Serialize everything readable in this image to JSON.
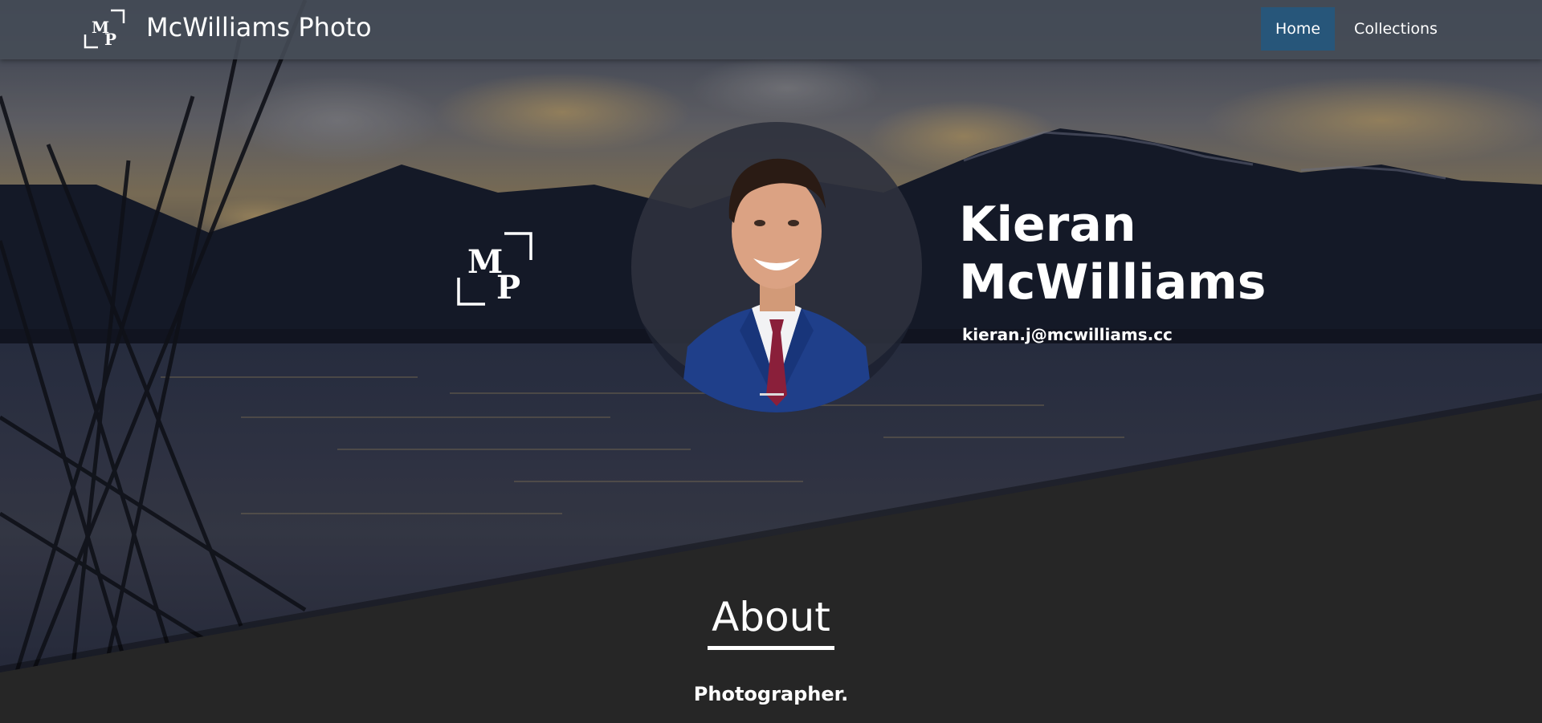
{
  "nav": {
    "brand": "McWilliams Photo",
    "logo_letters": [
      "M",
      "P"
    ],
    "links": [
      {
        "label": "Home",
        "active": true
      },
      {
        "label": "Collections",
        "active": false
      }
    ],
    "active_color": "#27567a"
  },
  "profile": {
    "name_first": "Kieran",
    "name_last": "McWilliams",
    "email": "kieran.j@mcwilliams.cc",
    "logo_letters": [
      "M",
      "P"
    ]
  },
  "about": {
    "title": "About",
    "subtitle": "Photographer."
  },
  "colors": {
    "background_dark": "#262626",
    "navbar": "#464c56",
    "text": "#ffffff"
  },
  "icons": [
    "mp-logo-icon"
  ]
}
